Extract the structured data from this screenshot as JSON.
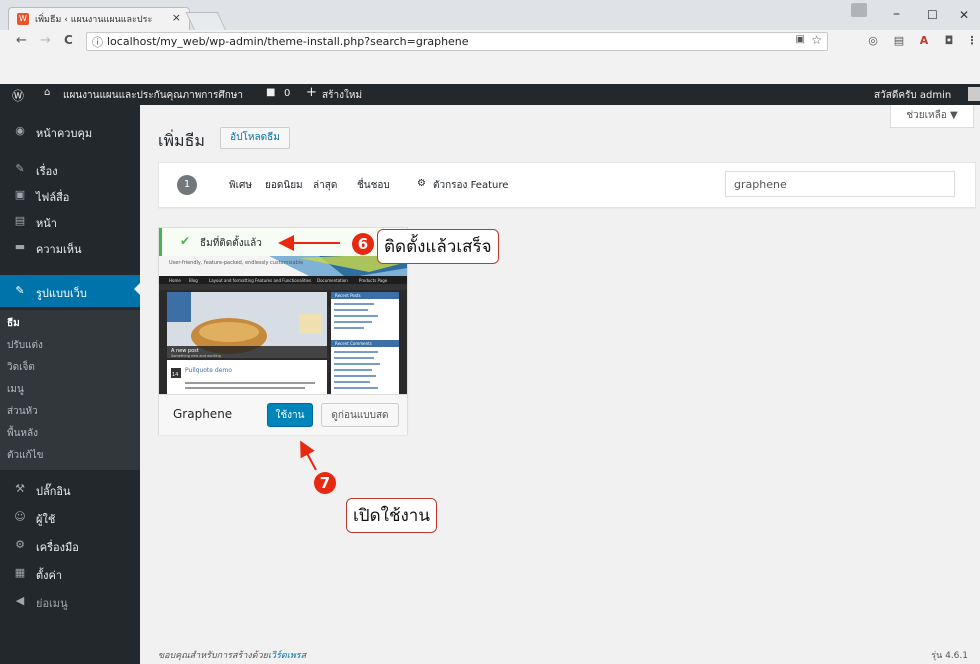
{
  "browser": {
    "tab_title": "เพิ่มธีม ‹ แผนงานแผนและประ",
    "tab_close": "×",
    "url": "localhost/my_web/wp-admin/theme-install.php?search=graphene",
    "back": "←",
    "forward": "→",
    "reload": "C",
    "info": "ⓘ",
    "win_minimize": "–",
    "win_maximize": "☐",
    "win_close": "✕",
    "star": "☆",
    "menu": "⋮"
  },
  "adminbar": {
    "wp_logo": "Ⓦ",
    "site_icon": "🏠",
    "site_name": "แผนงานแผนและประกันคุณภาพการศึกษา",
    "comments_icon": "■",
    "comments_count": "0",
    "new_icon": "+",
    "new_label": "สร้างใหม่",
    "greeting": "สวัสดีครับ admin"
  },
  "sidebar": {
    "items": [
      {
        "icon": "◉",
        "label": "หน้าควบคุม"
      },
      {
        "icon": "✎",
        "label": "เรื่อง"
      },
      {
        "icon": "▣",
        "label": "ไฟล์สื่อ"
      },
      {
        "icon": "▤",
        "label": "หน้า"
      },
      {
        "icon": "▬",
        "label": "ความเห็น"
      },
      {
        "icon": "✎",
        "label": "รูปแบบเว็บ"
      },
      {
        "icon": "⚒",
        "label": "ปลั๊กอิน"
      },
      {
        "icon": "☺",
        "label": "ผู้ใช้"
      },
      {
        "icon": "⚙",
        "label": "เครื่องมือ"
      },
      {
        "icon": "▦",
        "label": "ตั้งค่า"
      },
      {
        "icon": "◀",
        "label": "ย่อเมนู"
      }
    ],
    "submenu": [
      "ธีม",
      "ปรับแต่ง",
      "วิดเจ็ต",
      "เมนู",
      "ส่วนหัว",
      "พื้นหลัง",
      "ตัวแก้ไข"
    ]
  },
  "content": {
    "help": "ช่วยเหลือ ▼",
    "title": "เพิ่มธีม",
    "upload": "อัปโหลดธีม",
    "count": "1",
    "filters": [
      "พิเศษ",
      "ยอดนิยม",
      "ล่าสุด",
      "ชื่นชอบ"
    ],
    "feature_filter": "ตัวกรอง Feature",
    "search_value": "graphene",
    "installed_notice": "ธีมที่ติดตั้งแล้ว",
    "theme_name": "Graphene",
    "activate": "ใช้งาน",
    "preview": "ดูก่อนแบบสด",
    "footer_text": "ขอบคุณสำหรับการสร้างด้วย",
    "footer_link": "เวิร์ดเพรส",
    "version": "รุ่น 4.6.1"
  },
  "screenshot_preview": {
    "tagline": "User-friendly, feature-packed, endlessly customisable",
    "nav": [
      "Home",
      "Blog",
      "Layout and formatting",
      "Features and Functionalities",
      "Documentation",
      "Products Page"
    ],
    "post_caption": "A new post",
    "post_sub": "Something new and exciting",
    "widget1": "Recent Posts",
    "widget2": "Recent Comments",
    "post_title": "Pullquote demo",
    "day": "14"
  },
  "annotations": {
    "step6": "6",
    "step6_text": "ติดตั้งแล้วเสร็จ",
    "step7": "7",
    "step7_text": "เปิดใช้งาน"
  },
  "colors": {
    "admin_dark": "#23282d",
    "admin_blue": "#0073aa",
    "success_green": "#46b450",
    "annotation_red": "#e8280f"
  }
}
